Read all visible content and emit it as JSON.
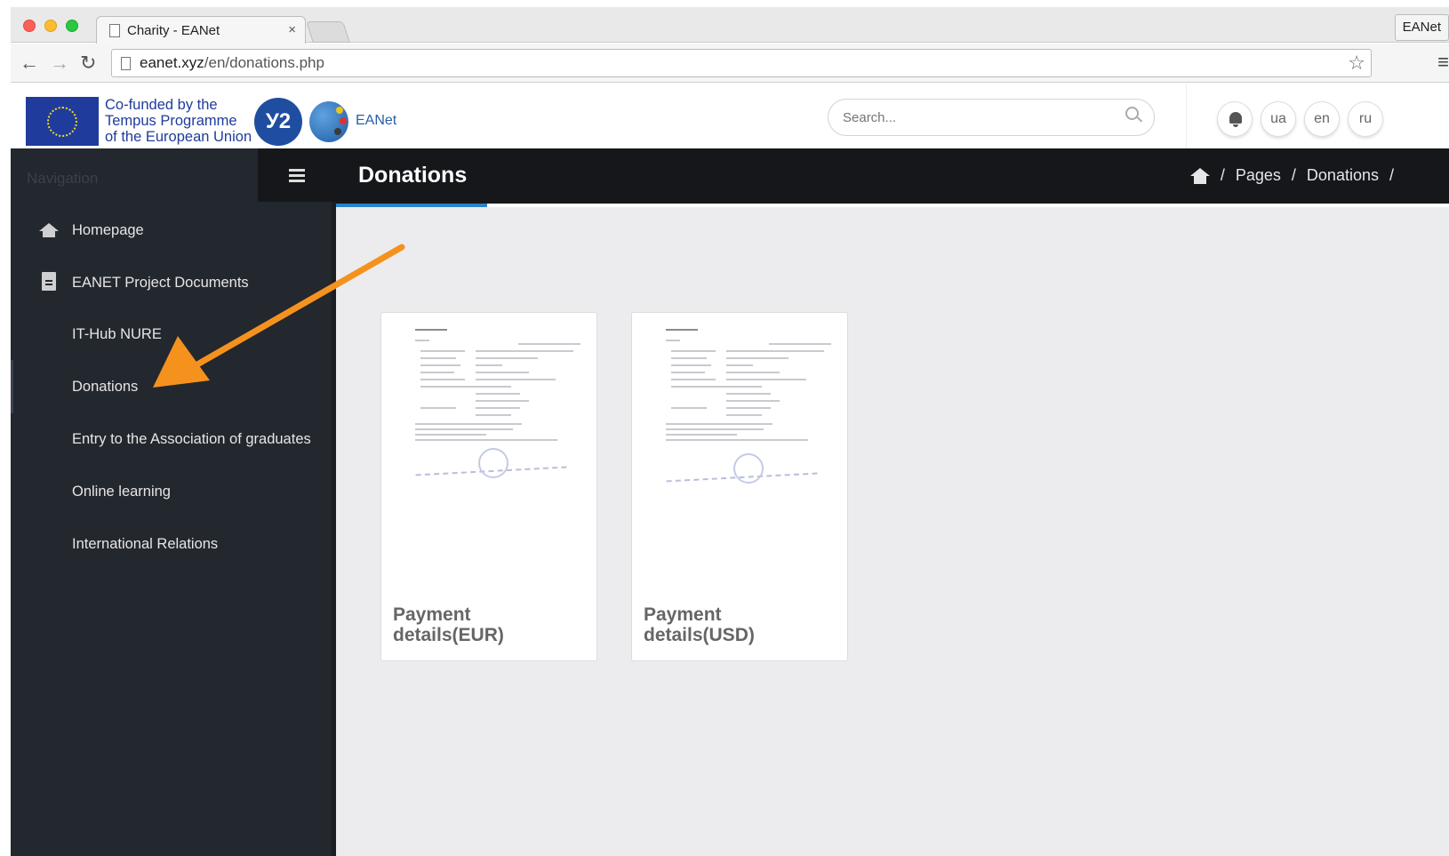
{
  "browser": {
    "tab_title": "Charity - EANet",
    "tab_close": "×",
    "profile": "EANet",
    "url_host": "eanet.xyz",
    "url_path": "/en/donations.php"
  },
  "header": {
    "cofund_line1": "Co-funded by the",
    "cofund_line2": "Tempus Programme",
    "cofund_line3": "of the European Union",
    "round_logo": "У2",
    "site_name": "EANet",
    "search_placeholder": "Search...",
    "lang_ua": "ua",
    "lang_en": "en",
    "lang_ru": "ru"
  },
  "sidebar": {
    "label": "Navigation",
    "items": [
      {
        "label": "Homepage"
      },
      {
        "label": "EANET Project Documents"
      },
      {
        "label": "IT-Hub NURE"
      },
      {
        "label": "Donations"
      },
      {
        "label": "Entry to the Association of graduates"
      },
      {
        "label": "Online learning"
      },
      {
        "label": "International Relations"
      }
    ]
  },
  "page": {
    "title": "Donations",
    "breadcrumb": [
      "Pages",
      "Donations"
    ],
    "separator": "/"
  },
  "cards": [
    {
      "line1": "Payment",
      "line2": "details(EUR)"
    },
    {
      "line1": "Payment",
      "line2": "details(USD)"
    }
  ],
  "colors": {
    "annotation_arrow": "#f5921e",
    "accent": "#2b82c8",
    "sidebar_bg": "#23272e"
  }
}
